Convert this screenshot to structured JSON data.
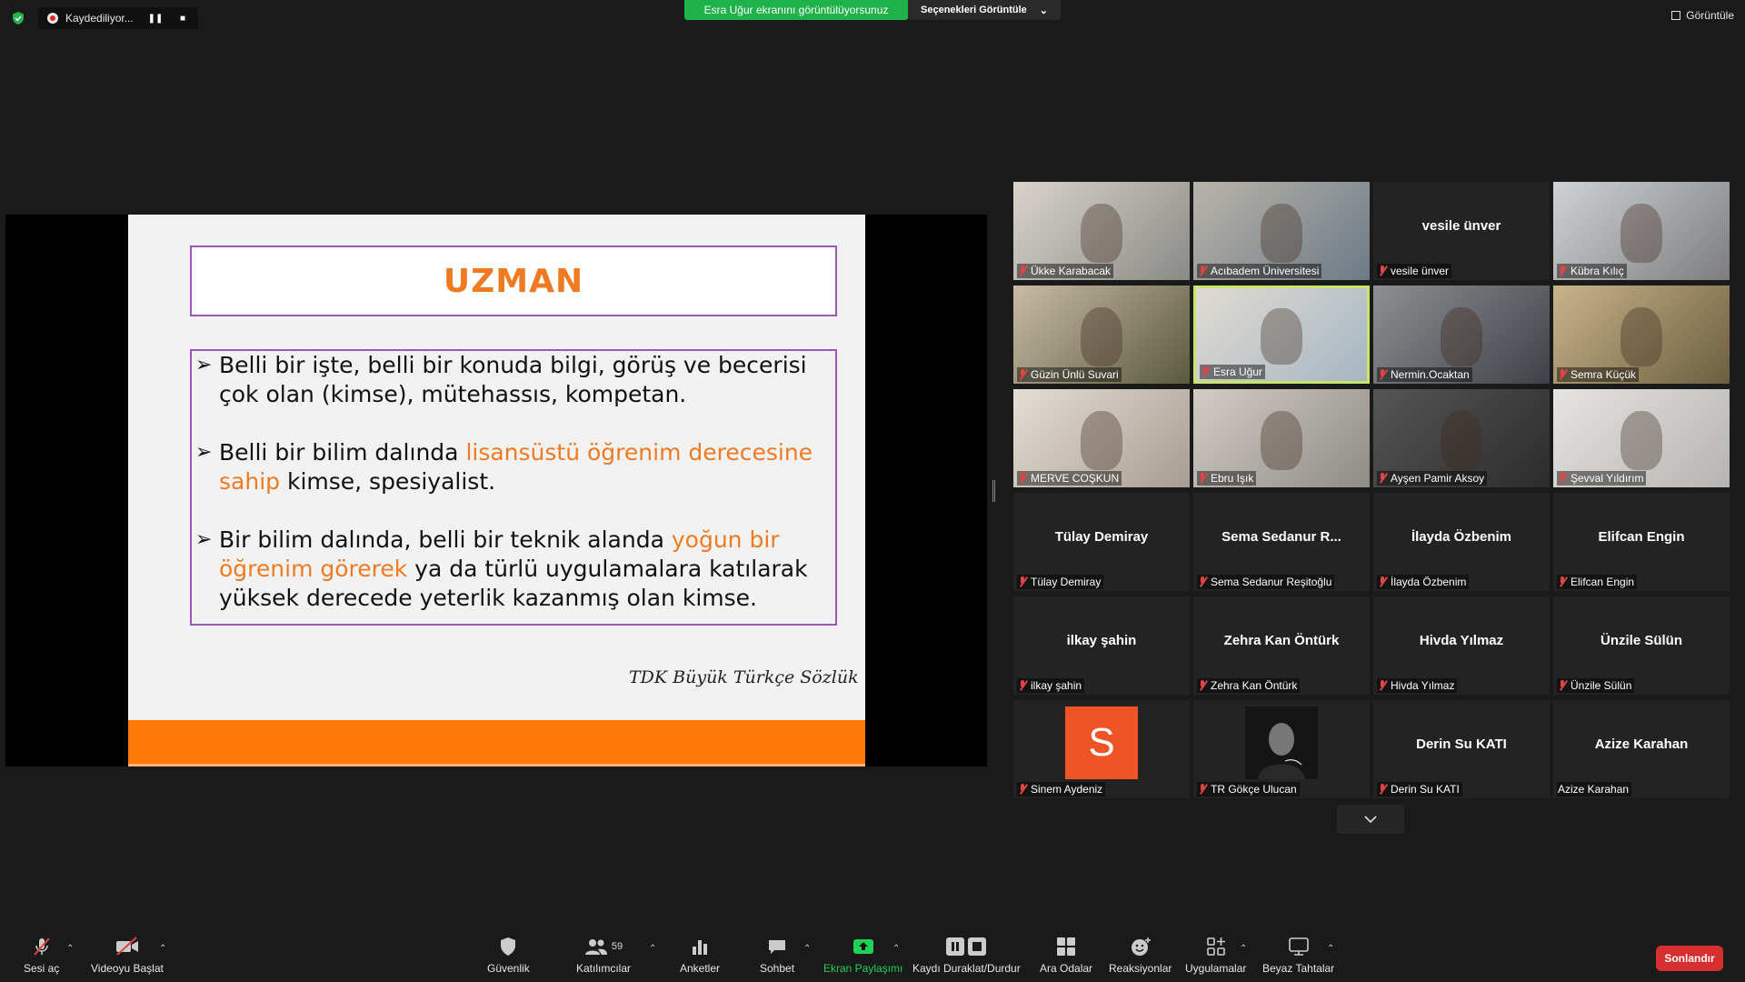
{
  "top_bar": {
    "recording_label": "Kaydediliyor...",
    "share_banner": "Esra Uğur ekranını görüntülüyorsunuz",
    "view_options_label": "Seçenekleri Görüntüle",
    "view_label": "Görüntüle"
  },
  "slide": {
    "title": "UZMAN",
    "bullet1": "Belli bir işte, belli bir konuda bilgi, görüş ve becerisi çok olan (kimse), mütehassıs, kompetan.",
    "bullet2_a": "Belli bir bilim dalında ",
    "bullet2_hl": "lisansüstü öğrenim derecesine sahip",
    "bullet2_b": " kimse, spesiyalist.",
    "bullet3_a": " Bir bilim dalında, belli bir teknik alanda ",
    "bullet3_hl": "yoğun bir öğrenim görerek",
    "bullet3_b": " ya da türlü uygulamalara katılarak yüksek derecede yeterlik kazanmış olan kimse.",
    "source": "TDK Büyük Türkçe Sözlük"
  },
  "participants": [
    {
      "name": "Ükke Karabacak",
      "video": true
    },
    {
      "name": "Acıbadem Üniversitesi",
      "video": true
    },
    {
      "name": "vesile ünver",
      "big": "vesile ünver"
    },
    {
      "name": "Kübra Kılıç",
      "video": true
    },
    {
      "name": "Güzin Ünlü Suvari",
      "video": true
    },
    {
      "name": "Esra Uğur",
      "video": true,
      "active": true
    },
    {
      "name": "Nermin.Ocaktan",
      "video": true
    },
    {
      "name": "Semra Küçük",
      "video": true
    },
    {
      "name": "MERVE COŞKUN",
      "video": true
    },
    {
      "name": "Ebru Işık",
      "video": true
    },
    {
      "name": "Ayşen Pamir Aksoy",
      "video": true
    },
    {
      "name": "Şevval Yıldırım",
      "video": true
    },
    {
      "name": "Tülay Demiray",
      "big": "Tülay Demiray"
    },
    {
      "name": "Sema Sedanur Reşitoğlu",
      "big": "Sema Sedanur R..."
    },
    {
      "name": "İlayda Özbenim",
      "big": "İlayda Özbenim"
    },
    {
      "name": "Elifcan Engin",
      "big": "Elifcan Engin"
    },
    {
      "name": "ilkay şahin",
      "big": "ilkay şahin"
    },
    {
      "name": "Zehra Kan Öntürk",
      "big": "Zehra Kan Öntürk"
    },
    {
      "name": "Hivda Yılmaz",
      "big": "Hivda Yılmaz"
    },
    {
      "name": "Ünzile Sülün",
      "big": "Ünzile Sülün"
    },
    {
      "name": "Sinem Aydeniz",
      "avatar": "S"
    },
    {
      "name": "TR Gökçe Ulucan",
      "avatar_img": true
    },
    {
      "name": "Derin Su KATI",
      "big": "Derin Su KATI"
    },
    {
      "name": "Azize Karahan",
      "big": "Azize Karahan",
      "unmuted": true
    }
  ],
  "toolbar": {
    "unmute": "Sesi aç",
    "start_video": "Videoyu Başlat",
    "security": "Güvenlik",
    "participants": "Katılımcılar",
    "participants_count": "59",
    "polls": "Anketler",
    "chat": "Sohbet",
    "share_screen": "Ekran Paylaşımı",
    "pause_record": "Kaydı Duraklat/Durdur",
    "breakout": "Ara Odalar",
    "reactions": "Reaksiyonlar",
    "apps": "Uygulamalar",
    "whiteboards": "Beyaz Tahtalar",
    "end": "Sonlandır"
  },
  "colors": {
    "accent_green": "#1fb14a",
    "slide_orange": "#f07a22",
    "end_red": "#d72f2f",
    "active_border": "#c7e56a"
  }
}
